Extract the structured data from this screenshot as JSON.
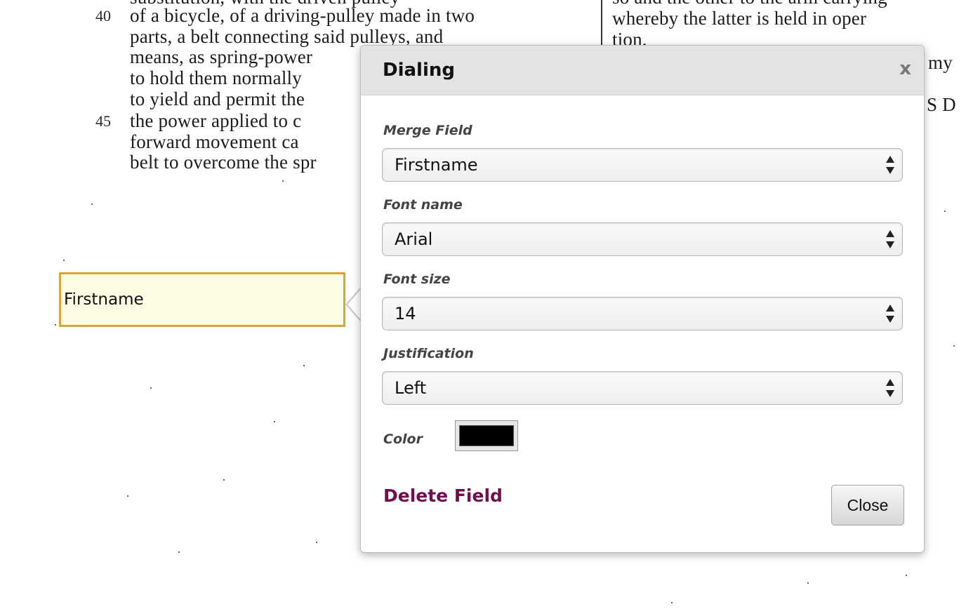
{
  "document": {
    "left_column": [
      "of a bicycle, of a driving-pulley made in two",
      "parts, a belt connecting said pulleys, and",
      "means, as spring-power",
      "to hold them normally",
      "to yield and permit the",
      "the power applied to c",
      "forward movement ca",
      "belt to overcome the spr"
    ],
    "line_numbers": [
      "40",
      "45"
    ],
    "right_column": [
      "whereby the latter is held in oper",
      "tion.",
      "my",
      "S D"
    ]
  },
  "merge_field_box": {
    "label": "Firstname"
  },
  "dialog": {
    "title": "Dialing",
    "close_glyph": "x",
    "merge_field": {
      "label": "Merge Field",
      "value": "Firstname"
    },
    "font_name": {
      "label": "Font name",
      "value": "Arial"
    },
    "font_size": {
      "label": "Font size",
      "value": "14"
    },
    "justification": {
      "label": "Justification",
      "value": "Left"
    },
    "color": {
      "label": "Color",
      "value": "#000000"
    },
    "delete_label": "Delete Field",
    "close_label": "Close"
  },
  "icons": [
    "close-icon",
    "select-arrows-icon"
  ],
  "colors": {
    "merge_field_border": "#d9a43a",
    "merge_field_fill": "#fefde3",
    "delete_link": "#6e0e4e"
  }
}
